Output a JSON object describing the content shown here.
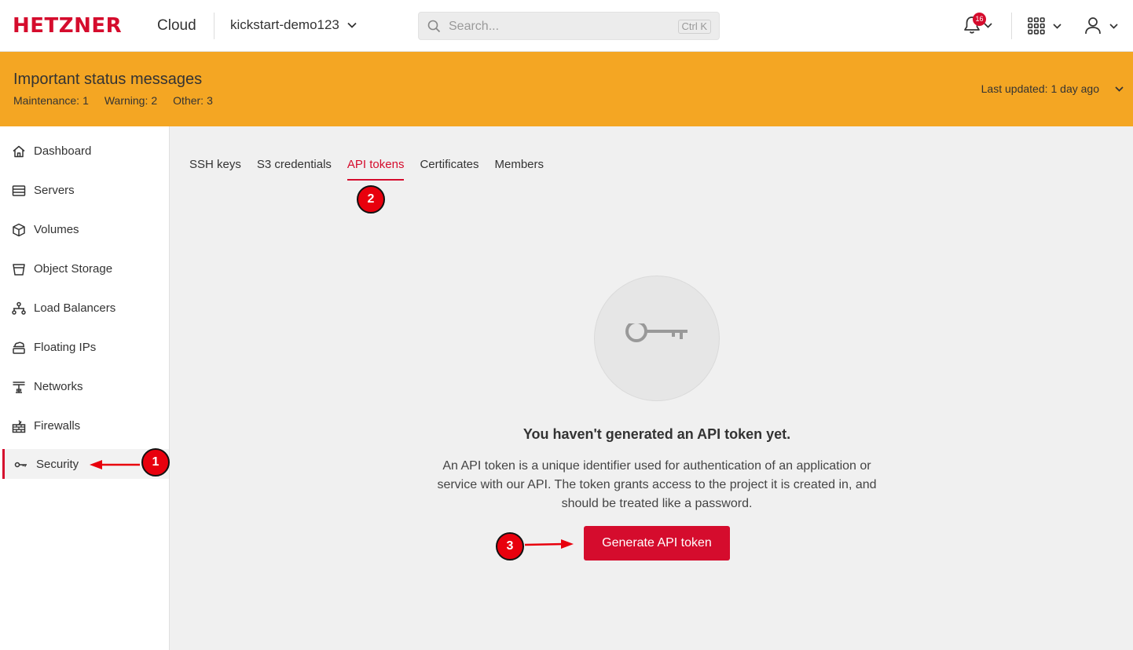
{
  "header": {
    "logo_text": "HETZNER",
    "product_label": "Cloud",
    "project_name": "kickstart-demo123",
    "search_placeholder": "Search...",
    "search_shortcut": "Ctrl K",
    "notification_count": "16",
    "icons": [
      "search-icon",
      "bell-icon",
      "apps-grid-icon",
      "user-icon",
      "chevron-down-icon"
    ]
  },
  "status_banner": {
    "title": "Important status messages",
    "counts": [
      {
        "label": "Maintenance:",
        "value": "1"
      },
      {
        "label": "Warning:",
        "value": "2"
      },
      {
        "label": "Other:",
        "value": "3"
      }
    ],
    "last_updated_label": "Last updated:",
    "last_updated_value": "1 day ago",
    "color": "#f4a623"
  },
  "sidebar": {
    "items": [
      {
        "label": "Dashboard",
        "icon": "home-icon"
      },
      {
        "label": "Servers",
        "icon": "server-icon"
      },
      {
        "label": "Volumes",
        "icon": "cube-icon"
      },
      {
        "label": "Object Storage",
        "icon": "bucket-icon"
      },
      {
        "label": "Load Balancers",
        "icon": "load-balancer-icon"
      },
      {
        "label": "Floating IPs",
        "icon": "floating-ip-icon"
      },
      {
        "label": "Networks",
        "icon": "network-icon"
      },
      {
        "label": "Firewalls",
        "icon": "firewall-icon"
      },
      {
        "label": "Security",
        "icon": "key-icon",
        "active": true
      }
    ]
  },
  "main": {
    "tabs": [
      {
        "label": "SSH keys"
      },
      {
        "label": "S3 credentials"
      },
      {
        "label": "API tokens",
        "active": true
      },
      {
        "label": "Certificates"
      },
      {
        "label": "Members"
      }
    ],
    "empty_state": {
      "icon": "key-icon",
      "title": "You haven't generated an API token yet.",
      "description": "An API token is a unique identifier used for authentication of an application or service with our API. The token grants access to the project it is created in, and should be treated like a password.",
      "button_label": "Generate API token"
    }
  },
  "annotations": {
    "markers": [
      "1",
      "2",
      "3"
    ],
    "color": "#e8000d"
  },
  "colors": {
    "brand": "#d50c2d",
    "banner": "#f4a623"
  }
}
